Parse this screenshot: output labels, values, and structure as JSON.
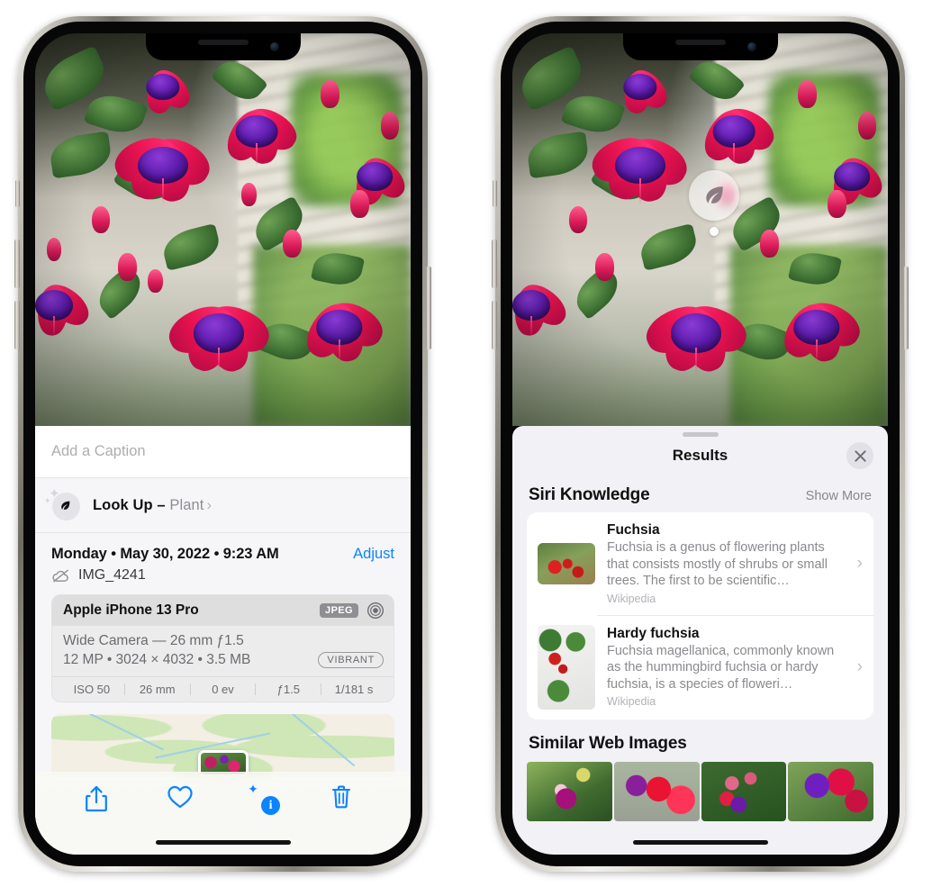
{
  "left_phone": {
    "caption": {
      "placeholder": "Add a Caption",
      "value": ""
    },
    "lookup": {
      "label": "Look Up –",
      "subject": "Plant",
      "chevron": "›",
      "icon": "leaf-icon",
      "sparkle": "✦"
    },
    "date_row": {
      "date": "Monday • May 30, 2022 • 9:23 AM",
      "adjust_label": "Adjust"
    },
    "file_row": {
      "filename": "IMG_4241",
      "icon": "cloud-slash-icon"
    },
    "metadata": {
      "device": "Apple iPhone 13 Pro",
      "format_tag": "JPEG",
      "lens_icon": "aperture-icon",
      "line1": "Wide Camera — 26 mm ƒ1.5",
      "line2": "12 MP • 3024 × 4032 • 3.5 MB",
      "style_tag": "VIBRANT",
      "exif": [
        "ISO 50",
        "26 mm",
        "0 ev",
        "ƒ1.5",
        "1/181 s"
      ]
    },
    "toolbar": [
      {
        "name": "share-button",
        "icon": "share-icon"
      },
      {
        "name": "favorite-button",
        "icon": "heart-icon"
      },
      {
        "name": "info-button",
        "icon": "info-sparkle-icon",
        "glyph": "i"
      },
      {
        "name": "delete-button",
        "icon": "trash-icon"
      }
    ]
  },
  "right_phone": {
    "visual_lookup_badge": {
      "icon": "leaf-icon"
    },
    "sheet": {
      "title": "Results",
      "close_label": "✕",
      "siri_section": {
        "title": "Siri Knowledge",
        "show_more": "Show More"
      },
      "knowledge_items": [
        {
          "title": "Fuchsia",
          "description": "Fuchsia is a genus of flowering plants that consists mostly of shrubs or small trees. The first to be scientific…",
          "source": "Wikipedia",
          "chevron": "›"
        },
        {
          "title": "Hardy fuchsia",
          "description": "Fuchsia magellanica, commonly known as the hummingbird fuchsia or hardy fuchsia, is a species of floweri…",
          "source": "Wikipedia",
          "chevron": "›"
        }
      ],
      "similar_section": {
        "title": "Similar Web Images",
        "thumbnail_count": 4
      }
    }
  },
  "colors": {
    "accent_blue": "#0a84ff",
    "sheet_background": "#f2f1f6",
    "card_background": "#ffffff",
    "secondary_text": "#8e8e93",
    "meta_card": "#ececed"
  }
}
